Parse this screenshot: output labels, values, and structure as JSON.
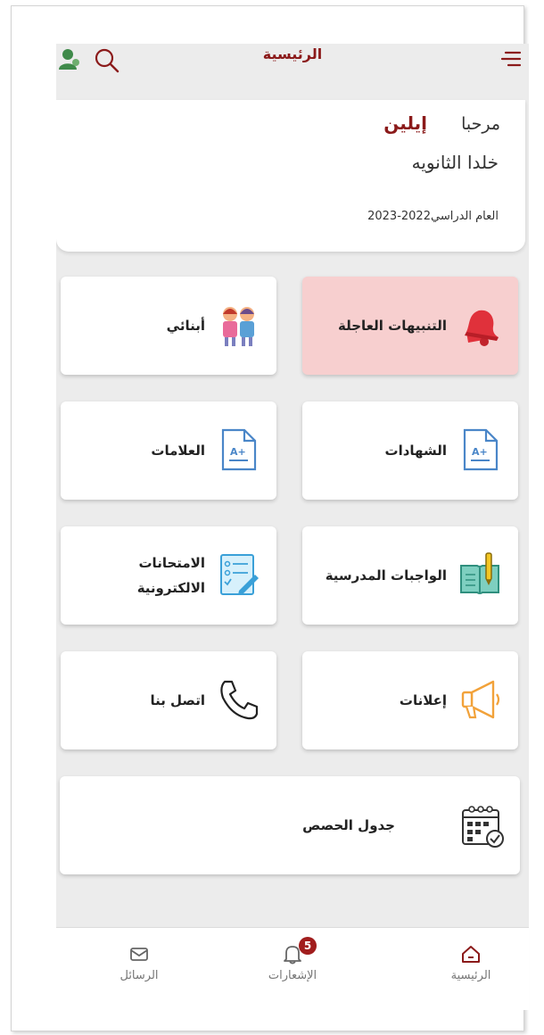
{
  "header": {
    "title": "الرئيسية",
    "menu_icon": "menu-icon",
    "search_icon": "search-icon",
    "user_icon": "user-icon"
  },
  "welcome": {
    "greeting": "مرحبا",
    "name": "إيلين",
    "school": "خلدا الثانويه",
    "academic_year": "العام الدراسي2022-2023"
  },
  "tiles": {
    "alerts": {
      "label": "التنبيهات العاجلة",
      "icon": "bell-icon"
    },
    "children": {
      "label": "أبنائي",
      "icon": "children-icon"
    },
    "certificates": {
      "label": "الشهادات",
      "icon": "certificate-document-icon"
    },
    "grades": {
      "label": "العلامات",
      "icon": "grades-document-icon"
    },
    "homework": {
      "label": "الواجبات المدرسية",
      "icon": "homework-book-icon"
    },
    "exams": {
      "label_line1": "الامتحانات",
      "label_line2": "الالكترونية",
      "icon": "exam-checklist-icon"
    },
    "announcements": {
      "label": "إعلانات",
      "icon": "megaphone-icon"
    },
    "contact": {
      "label": "اتصل بنا",
      "icon": "phone-icon"
    },
    "schedule": {
      "label": "جدول الحصص",
      "icon": "calendar-icon"
    }
  },
  "bottom_nav": {
    "home": {
      "label": "الرئيسية",
      "icon": "home-icon"
    },
    "notifications": {
      "label": "الإشعارات",
      "icon": "bell-outline-icon",
      "badge": "5"
    },
    "messages": {
      "label": "الرسائل",
      "icon": "envelope-icon"
    }
  },
  "colors": {
    "brand": "#8b1a1a",
    "alert_tile": "#f7cfcf",
    "background": "#ececec",
    "icon_blue": "#4a86c8",
    "badge": "#a11d1d"
  }
}
